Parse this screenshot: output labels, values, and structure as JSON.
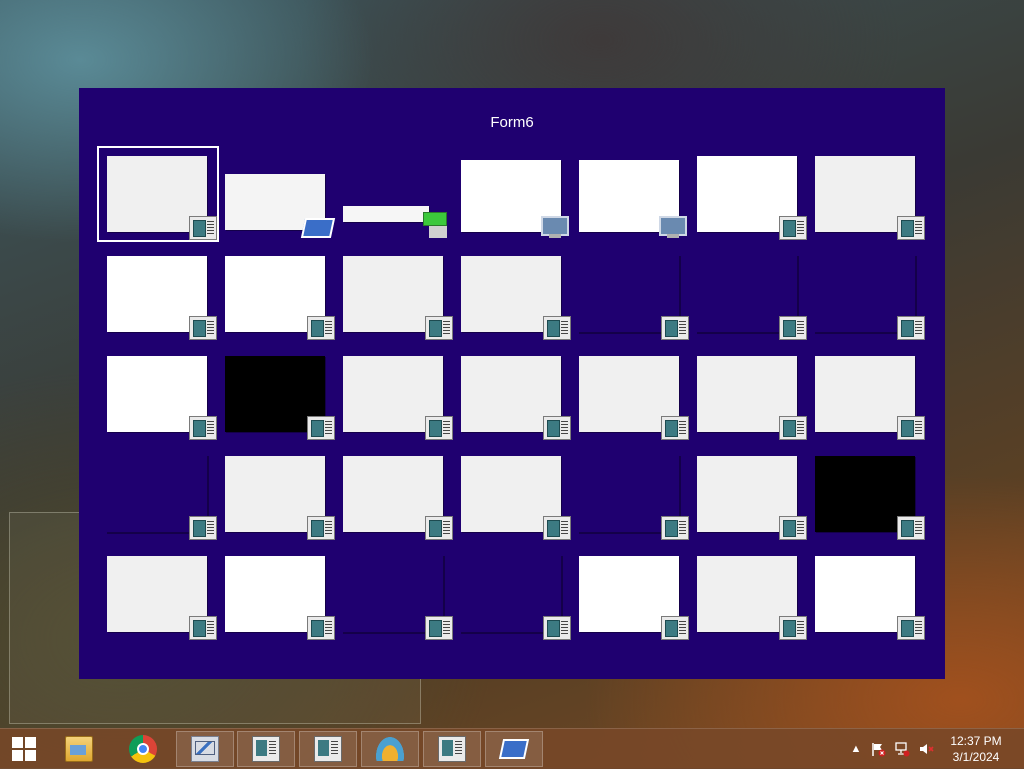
{
  "switcher": {
    "title": "Form6",
    "thumbnails": [
      {
        "kind": "light",
        "badge": "form-icon",
        "selected": true
      },
      {
        "kind": "dialog",
        "badge": "remote-desktop-icon"
      },
      {
        "kind": "small",
        "badge": "battery-icon"
      },
      {
        "kind": "tm",
        "badge": "performance-monitor-icon"
      },
      {
        "kind": "tm",
        "badge": "computer-icon"
      },
      {
        "kind": "white",
        "badge": "form-icon"
      },
      {
        "kind": "light",
        "badge": "form-icon"
      },
      {
        "kind": "white",
        "badge": "form-icon"
      },
      {
        "kind": "white",
        "badge": "form-icon"
      },
      {
        "kind": "light",
        "badge": "form-icon"
      },
      {
        "kind": "light",
        "badge": "form-icon"
      },
      {
        "kind": "clear",
        "badge": "form-icon"
      },
      {
        "kind": "clear",
        "badge": "form-icon"
      },
      {
        "kind": "clear",
        "badge": "form-icon"
      },
      {
        "kind": "white",
        "badge": "form-icon"
      },
      {
        "kind": "black",
        "badge": "form-icon"
      },
      {
        "kind": "light",
        "badge": "form-icon"
      },
      {
        "kind": "light",
        "badge": "form-icon"
      },
      {
        "kind": "light",
        "badge": "form-icon"
      },
      {
        "kind": "light",
        "badge": "form-icon"
      },
      {
        "kind": "light",
        "badge": "form-icon"
      },
      {
        "kind": "clear",
        "badge": "form-icon"
      },
      {
        "kind": "light",
        "badge": "form-icon"
      },
      {
        "kind": "light",
        "badge": "form-icon"
      },
      {
        "kind": "light",
        "badge": "form-icon"
      },
      {
        "kind": "clear",
        "badge": "form-icon"
      },
      {
        "kind": "light",
        "badge": "form-icon"
      },
      {
        "kind": "black",
        "badge": "form-icon"
      },
      {
        "kind": "light",
        "badge": "form-icon"
      },
      {
        "kind": "white",
        "badge": "form-icon"
      },
      {
        "kind": "clear",
        "badge": "form-icon"
      },
      {
        "kind": "clear",
        "badge": "form-icon"
      },
      {
        "kind": "white",
        "badge": "form-icon"
      },
      {
        "kind": "light",
        "badge": "form-icon"
      },
      {
        "kind": "white",
        "badge": "form-icon"
      }
    ]
  },
  "taskbar": {
    "start_label": "Start",
    "buttons": [
      {
        "name": "file-explorer",
        "icon": "explorer",
        "pinned": true
      },
      {
        "name": "chrome",
        "icon": "chrome",
        "pinned": true
      },
      {
        "name": "performance-monitor",
        "icon": "perf",
        "pinned": false
      },
      {
        "name": "form-app-1",
        "icon": "form",
        "pinned": false
      },
      {
        "name": "form-app-2",
        "icon": "form",
        "pinned": false
      },
      {
        "name": "shell-app",
        "icon": "shell",
        "pinned": false
      },
      {
        "name": "form-app-3",
        "icon": "form",
        "pinned": false
      },
      {
        "name": "remote-desktop",
        "icon": "rdp",
        "pinned": false
      }
    ],
    "tray": {
      "show_hidden": "▲",
      "clock_time": "12:37 PM",
      "clock_date": "3/1/2024"
    }
  },
  "colors": {
    "switcher_bg": "#1f0070",
    "taskbar_bg": "#784828"
  }
}
